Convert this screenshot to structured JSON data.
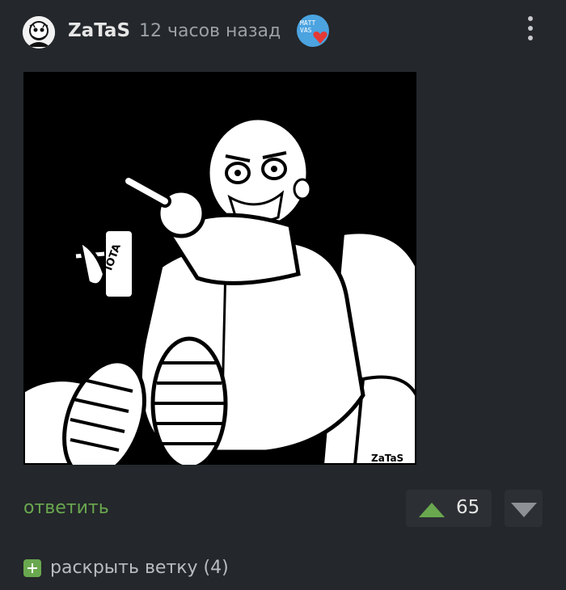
{
  "post": {
    "username": "ZaTaS",
    "time_ago": "12 часов назад",
    "badge_text": "MATT VAS",
    "image_signature": "ZaTaS",
    "image_can_label": "IOTA"
  },
  "actions": {
    "reply_label": "ответить",
    "vote_count": "65",
    "expand_label": "раскрыть ветку (4)"
  },
  "colors": {
    "background": "#24272b",
    "accent_green": "#6aa84f",
    "vote_box": "#2c2f34"
  },
  "icons": [
    "avatar",
    "badge-heart-icon",
    "more-vertical-icon",
    "upvote-icon",
    "downvote-icon",
    "plus-icon"
  ]
}
